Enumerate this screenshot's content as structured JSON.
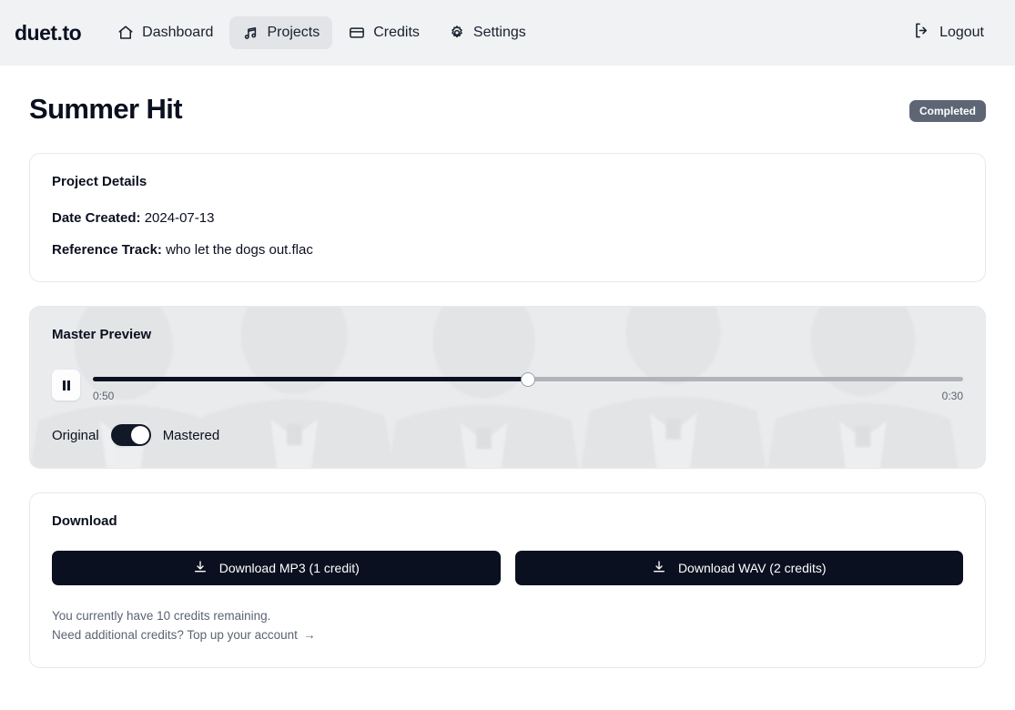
{
  "header": {
    "brand": "duet.to",
    "nav": [
      {
        "label": "Dashboard",
        "icon": "home-icon",
        "active": false
      },
      {
        "label": "Projects",
        "icon": "music-note-icon",
        "active": true
      },
      {
        "label": "Credits",
        "icon": "credit-card-icon",
        "active": false
      },
      {
        "label": "Settings",
        "icon": "gear-icon",
        "active": false
      }
    ],
    "logout_label": "Logout",
    "logout_icon": "logout-icon",
    "background": "#f1f2f4"
  },
  "page": {
    "title": "Summer Hit",
    "status_badge": "Completed",
    "status_color": "#5e6675"
  },
  "details": {
    "title": "Project Details",
    "rows": [
      {
        "label": "Date Created:",
        "value": "2024-07-13"
      },
      {
        "label": "Reference Track:",
        "value": "who let the dogs out.flac"
      }
    ]
  },
  "preview": {
    "title": "Master Preview",
    "play_state": "paused",
    "play_icon": "pause-icon",
    "current_time": "0:50",
    "total_time": "0:30",
    "progress_percent": 50,
    "toggle_left_label": "Original",
    "toggle_right_label": "Mastered",
    "toggle_state": "Mastered"
  },
  "download": {
    "title": "Download",
    "buttons": [
      {
        "label": "Download MP3 (1 credit)",
        "icon": "download-icon"
      },
      {
        "label": "Download WAV (2 credits)",
        "icon": "download-icon"
      }
    ],
    "credits_remaining_text": "You currently have 10 credits remaining.",
    "topup_text": "Need additional credits? Top up your account",
    "topup_arrow": "→"
  }
}
